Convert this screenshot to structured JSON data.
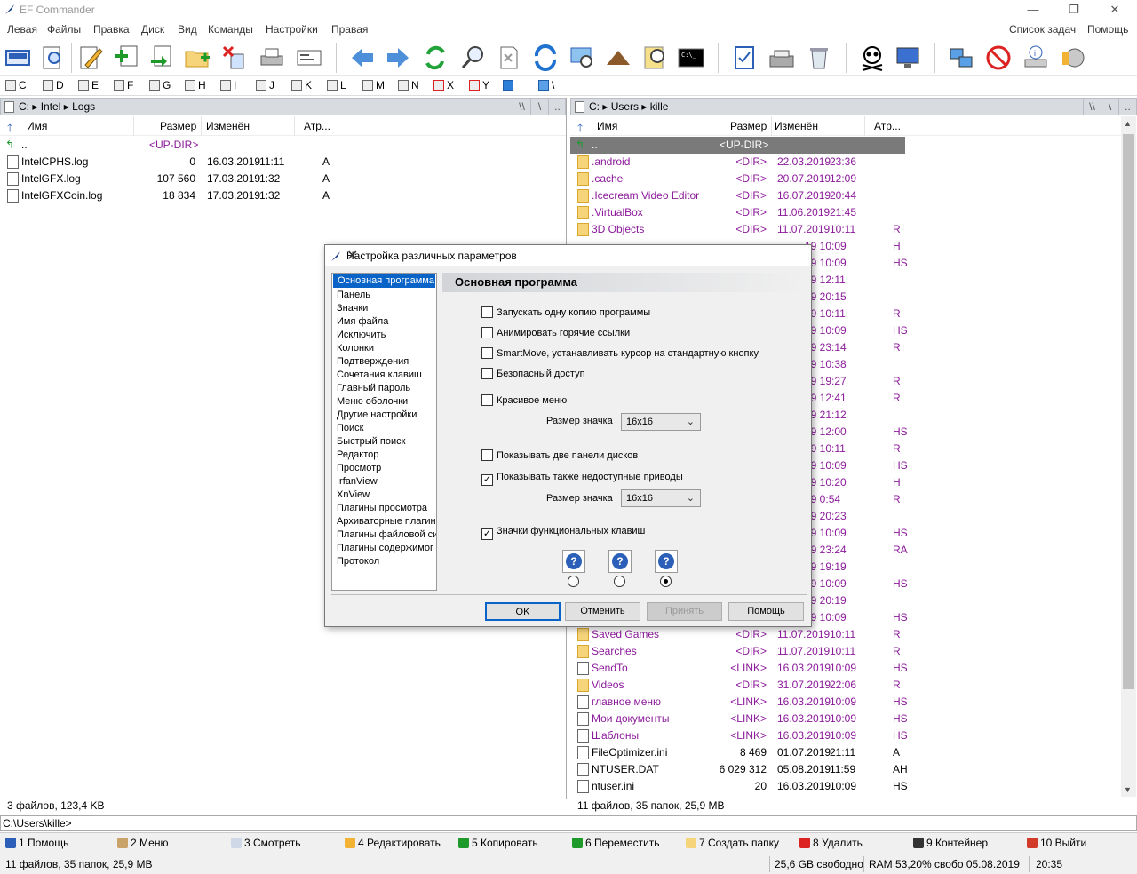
{
  "window": {
    "title": "EF Commander",
    "controls": [
      "—",
      "❐",
      "✕"
    ]
  },
  "menu": {
    "left": [
      "Левая",
      "Файлы",
      "Правка",
      "Диск",
      "Вид",
      "Команды",
      "Настройки",
      "Правая"
    ],
    "right": [
      "Список задач",
      "Помощь"
    ]
  },
  "drives": [
    "C",
    "D",
    "E",
    "F",
    "G",
    "H",
    "I",
    "J",
    "K",
    "L",
    "M",
    "N",
    "X",
    "Y",
    "",
    "\\"
  ],
  "left": {
    "path": [
      "C:",
      "Intel",
      "Logs"
    ],
    "path_buttons": [
      "\\\\",
      "\\",
      ".."
    ],
    "columns": [
      "Имя",
      "Размер",
      "Изменён",
      "Атр..."
    ],
    "updir": {
      "name": "..",
      "size": "<UP-DIR>"
    },
    "files": [
      {
        "name": "IntelCPHS.log",
        "size": "0",
        "date": "16.03.2019",
        "time": "11:11",
        "attr": "A"
      },
      {
        "name": "IntelGFX.log",
        "size": "107 560",
        "date": "17.03.2019",
        "time": "1:32",
        "attr": "A"
      },
      {
        "name": "IntelGFXCoin.log",
        "size": "18 834",
        "date": "17.03.2019",
        "time": "1:32",
        "attr": "A"
      }
    ],
    "status": "3 файлов, 123,4 KB"
  },
  "right": {
    "path": [
      "C:",
      "Users",
      "kille"
    ],
    "path_buttons": [
      "\\\\",
      "\\",
      ".."
    ],
    "columns": [
      "Имя",
      "Размер",
      "Изменён",
      "Атр..."
    ],
    "updir": {
      "name": "..",
      "size": "<UP-DIR>"
    },
    "top_files": [
      {
        "name": ".android",
        "size": "<DIR>",
        "date": "22.03.2019",
        "time": "23:36",
        "attr": ""
      },
      {
        "name": ".cache",
        "size": "<DIR>",
        "date": "20.07.2019",
        "time": "12:09",
        "attr": ""
      },
      {
        "name": ".Icecream Video Editor",
        "size": "<DIR>",
        "date": "16.07.2019",
        "time": "20:44",
        "attr": ""
      },
      {
        "name": ".VirtualBox",
        "size": "<DIR>",
        "date": "11.06.2019",
        "time": "21:45",
        "attr": ""
      },
      {
        "name": "3D Objects",
        "size": "<DIR>",
        "date": "11.07.2019",
        "time": "10:11",
        "attr": "R"
      }
    ],
    "hidden_rows": [
      {
        "t": "19 10:09",
        "a": "H"
      },
      {
        "t": "19 10:09",
        "a": "HS"
      },
      {
        "t": "19 12:11",
        "a": ""
      },
      {
        "t": "19 20:15",
        "a": ""
      },
      {
        "t": "19 10:11",
        "a": "R"
      },
      {
        "t": "19 10:09",
        "a": "HS"
      },
      {
        "t": "19 23:14",
        "a": "R"
      },
      {
        "t": "19 10:38",
        "a": ""
      },
      {
        "t": "19 19:27",
        "a": "R"
      },
      {
        "t": "19 12:41",
        "a": "R"
      },
      {
        "t": "19 21:12",
        "a": ""
      },
      {
        "t": "19 12:00",
        "a": "HS"
      },
      {
        "t": "19 10:11",
        "a": "R"
      },
      {
        "t": "19 10:09",
        "a": "HS"
      },
      {
        "t": "19 10:20",
        "a": "H"
      },
      {
        "t": "19 0:54",
        "a": "R"
      },
      {
        "t": "19 20:23",
        "a": ""
      },
      {
        "t": "19 10:09",
        "a": "HS"
      },
      {
        "t": "19 23:24",
        "a": "RA"
      },
      {
        "t": "19 19:19",
        "a": ""
      },
      {
        "t": "19 10:09",
        "a": "HS"
      },
      {
        "t": "19 20:19",
        "a": ""
      },
      {
        "t": "19 10:09",
        "a": "HS"
      }
    ],
    "bottom_files": [
      {
        "name": "Saved Games",
        "size": "<DIR>",
        "date": "11.07.2019",
        "time": "10:11",
        "attr": "R",
        "kind": "dir"
      },
      {
        "name": "Searches",
        "size": "<DIR>",
        "date": "11.07.2019",
        "time": "10:11",
        "attr": "R",
        "kind": "dir"
      },
      {
        "name": "SendTo",
        "size": "<LINK>",
        "date": "16.03.2019",
        "time": "10:09",
        "attr": "HS",
        "kind": "link"
      },
      {
        "name": "Videos",
        "size": "<DIR>",
        "date": "31.07.2019",
        "time": "22:06",
        "attr": "R",
        "kind": "dir"
      },
      {
        "name": "главное меню",
        "size": "<LINK>",
        "date": "16.03.2019",
        "time": "10:09",
        "attr": "HS",
        "kind": "link"
      },
      {
        "name": "Мои документы",
        "size": "<LINK>",
        "date": "16.03.2019",
        "time": "10:09",
        "attr": "HS",
        "kind": "link"
      },
      {
        "name": "Шаблоны",
        "size": "<LINK>",
        "date": "16.03.2019",
        "time": "10:09",
        "attr": "HS",
        "kind": "link"
      },
      {
        "name": "FileOptimizer.ini",
        "size": "8 469",
        "date": "01.07.2019",
        "time": "21:11",
        "attr": "A",
        "kind": "file"
      },
      {
        "name": "NTUSER.DAT",
        "size": "6 029 312",
        "date": "05.08.2019",
        "time": "11:59",
        "attr": "AH",
        "kind": "file"
      },
      {
        "name": "ntuser.ini",
        "size": "20",
        "date": "16.03.2019",
        "time": "10:09",
        "attr": "HS",
        "kind": "file"
      }
    ],
    "status": "11 файлов, 35 папок, 25,9 MB"
  },
  "cmdline": "C:\\Users\\kille>",
  "fkeys": [
    "1 Помощь",
    "2 Меню",
    "3 Смотреть",
    "4 Редактировать",
    "5 Копировать",
    "6 Переместить",
    "7 Создать папку",
    "8 Удалить",
    "9 Контейнер",
    "10 Выйти"
  ],
  "bottom": {
    "summary": "11 файлов, 35 папок, 25,9 MB",
    "free": "25,6 GB свободно",
    "ram": "RAM 53,20% свобо 05.08.2019",
    "time": "20:35"
  },
  "dialog": {
    "title": "Настройка различных параметров",
    "close": "✕",
    "heading": "Основная программа",
    "categories": [
      "Основная программа",
      "Панель",
      "Значки",
      "Имя файла",
      "Исключить",
      "Колонки",
      "Подтверждения",
      "Сочетания клавиш",
      "Главный пароль",
      "Меню оболочки",
      "Другие настройки",
      "Поиск",
      "Быстрый поиск",
      "Редактор",
      "Просмотр",
      "IrfanView",
      "XnView",
      "Плагины просмотра",
      "Архиваторные плагин",
      "Плагины файловой си",
      "Плагины содержимог",
      "Протокол"
    ],
    "options": {
      "single": "Запускать одну копию программы",
      "animate": "Анимировать горячие ссылки",
      "smartmove": "SmartMove, устанавливать курсор на стандартную кнопку",
      "safe": "Безопасный доступ",
      "beauty": "Красивое меню",
      "twopanel": "Показывать две панели дисков",
      "inaccessible": "Показывать также недоступные приводы",
      "fkeyicons": "Значки функциональных клавиш"
    },
    "checked": {
      "single": false,
      "animate": false,
      "smartmove": false,
      "safe": false,
      "beauty": false,
      "twopanel": false,
      "inaccessible": true,
      "fkeyicons": true
    },
    "icon_size_label": "Размер значка",
    "icon_size_value": "16x16",
    "icon_size_value2": "16x16",
    "radio_selected": 3,
    "buttons": {
      "ok": "OK",
      "cancel": "Отменить",
      "apply": "Принять",
      "help": "Помощь"
    }
  }
}
